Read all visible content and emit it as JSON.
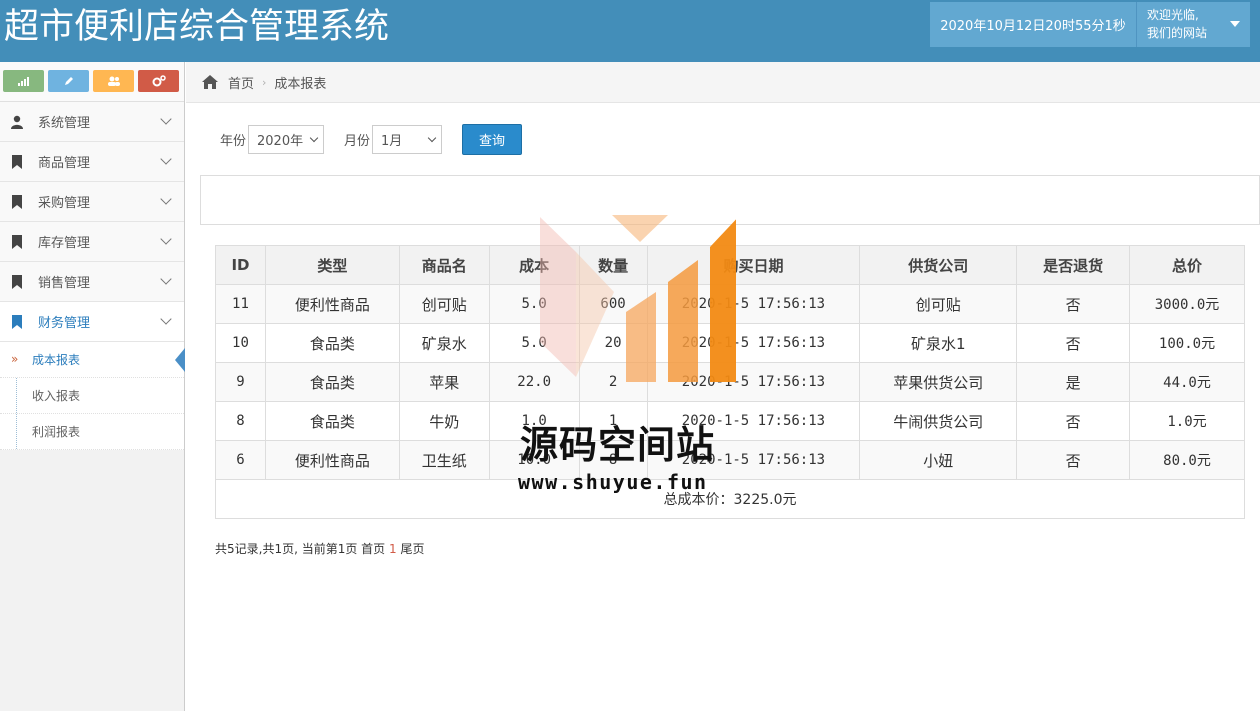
{
  "header": {
    "title": "超市便利店综合管理系统",
    "datetime": "2020年10月12日20时55分1秒",
    "welcome_line1": "欢迎光临,",
    "welcome_line2": "我们的网站"
  },
  "sidebar": {
    "shortcut_icons": [
      "signal-icon",
      "pencil-icon",
      "users-icon",
      "cogs-icon"
    ],
    "items": [
      {
        "label": "系统管理",
        "icon": "user-icon"
      },
      {
        "label": "商品管理",
        "icon": "bookmark-icon"
      },
      {
        "label": "采购管理",
        "icon": "bookmark-icon"
      },
      {
        "label": "库存管理",
        "icon": "bookmark-icon"
      },
      {
        "label": "销售管理",
        "icon": "bookmark-icon"
      },
      {
        "label": "财务管理",
        "icon": "bookmark-icon"
      }
    ],
    "subitems": [
      {
        "label": "成本报表"
      },
      {
        "label": "收入报表"
      },
      {
        "label": "利润报表"
      }
    ]
  },
  "breadcrumb": {
    "home": "首页",
    "current": "成本报表"
  },
  "filter": {
    "year_label": "年份",
    "year_value": "2020年",
    "month_label": "月份",
    "month_value": "1月",
    "query_button": "查询"
  },
  "table": {
    "headers": [
      "ID",
      "类型",
      "商品名",
      "成本",
      "数量",
      "购买日期",
      "供货公司",
      "是否退货",
      "总价"
    ],
    "rows": [
      [
        "11",
        "便利性商品",
        "创可贴",
        "5.0",
        "600",
        "2020-1-5  17:56:13",
        "创可贴",
        "否",
        "3000.0元"
      ],
      [
        "10",
        "食品类",
        "矿泉水",
        "5.0",
        "20",
        "2020-1-5  17:56:13",
        "矿泉水1",
        "否",
        "100.0元"
      ],
      [
        "9",
        "食品类",
        "苹果",
        "22.0",
        "2",
        "2020-1-5  17:56:13",
        "苹果供货公司",
        "是",
        "44.0元"
      ],
      [
        "8",
        "食品类",
        "牛奶",
        "1.0",
        "1",
        "2020-1-5  17:56:13",
        "牛闹供货公司",
        "否",
        "1.0元"
      ],
      [
        "6",
        "便利性商品",
        "卫生纸",
        "10.0",
        "8",
        "2020-1-5  17:56:13",
        "小妞",
        "否",
        "80.0元"
      ]
    ],
    "total": "总成本价：3225.0元"
  },
  "pager": {
    "summary": "共5记录,共1页, 当前第1页 首页",
    "current": "1",
    "last": "尾页"
  },
  "watermark": {
    "text": "源码空间站",
    "url": "www.shuyue.fun"
  },
  "colors": {
    "header_bg": "#438eb9",
    "accent": "#2b7dbc",
    "button": "#2a8bcc"
  }
}
